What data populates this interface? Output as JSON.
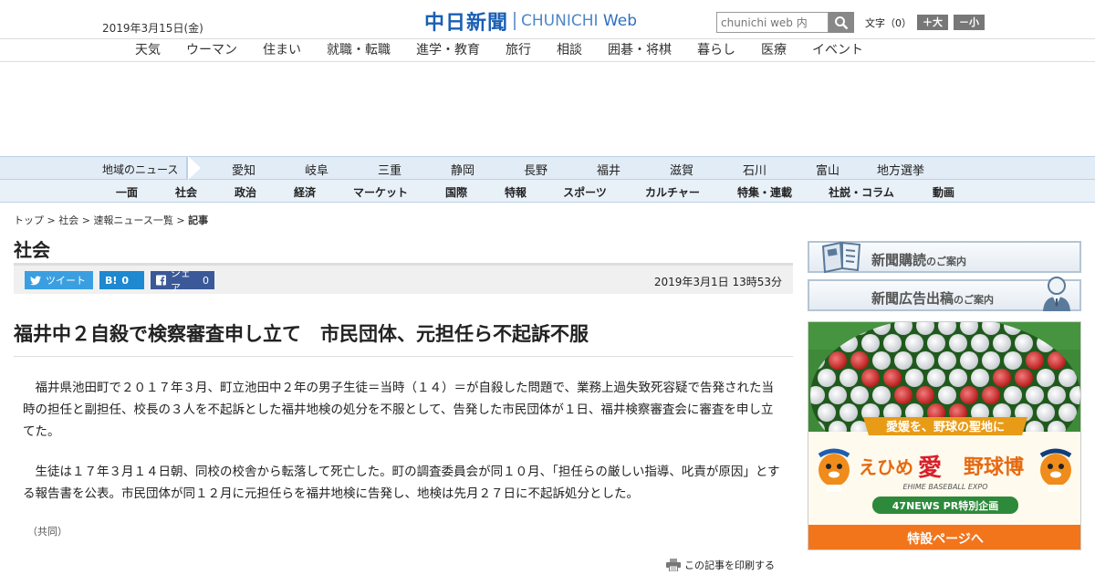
{
  "header": {
    "date": "2019年3月15日(金)",
    "logo_kanji": "中日新聞",
    "logo_en": "CHUNICHI",
    "logo_web": "Web",
    "search_placeholder": "chunichi web 内",
    "fontsize_label": "文字（0）",
    "fontsize_up": "＋大",
    "fontsize_down": "－小"
  },
  "subnav": [
    "天気",
    "ウーマン",
    "住まい",
    "就職・転職",
    "進学・教育",
    "旅行",
    "相談",
    "囲碁・将棋",
    "暮らし",
    "医療",
    "イベント"
  ],
  "region_nav": {
    "label": "地域のニュース",
    "items": [
      "愛知",
      "岐阜",
      "三重",
      "静岡",
      "長野",
      "福井",
      "滋賀",
      "石川",
      "富山",
      "地方選挙"
    ]
  },
  "main_nav": [
    "一面",
    "社会",
    "政治",
    "経済",
    "マーケット",
    "国際",
    "特報",
    "スポーツ",
    "カルチャー",
    "特集・連載",
    "社説・コラム",
    "動画"
  ],
  "breadcrumb": {
    "top": "トップ",
    "section": "社会",
    "list": "速報ニュース一覧",
    "current": "記事",
    "sep": " > "
  },
  "section_title": "社会",
  "share": {
    "tweet": "ツイート",
    "hatena_label": "B!",
    "hatena_count": "0",
    "fb_label": "シェア",
    "fb_count": "0"
  },
  "article": {
    "published": "2019年3月1日 13時53分",
    "headline": "福井中２自殺で検察審査申し立て　市民団体、元担任ら不起訴不服",
    "paragraphs": [
      "　福井県池田町で２０１７年３月、町立池田中２年の男子生徒＝当時（１４）＝が自殺した問題で、業務上過失致死容疑で告発された当時の担任と副担任、校長の３人を不起訴とした福井地検の処分を不服として、告発した市民団体が１日、福井検察審査会に審査を申し立てた。",
      "　生徒は１７年３月１４日朝、同校の校舎から転落して死亡した。町の調査委員会が同１０月、「担任らの厳しい指導、叱責が原因」とする報告書を公表。市民団体が同１２月に元担任らを福井地検に告発し、地検は先月２７日に不起訴処分とした。"
    ],
    "credit": "（共同）",
    "print_label": "この記事を印刷する"
  },
  "sidebar": {
    "banner1_main": "新聞購読",
    "banner1_sub": "のご案内",
    "banner2_main": "新聞広告出稿",
    "banner2_sub": "のご案内",
    "ad": {
      "catch": "愛媛を、野球の聖地に",
      "title_a": "えひめ",
      "title_b": "愛",
      "title_c": "野球博",
      "title_en": "EHIME BASEBALL EXPO",
      "pr": "47NEWS PR特別企画",
      "cta": "特設ページへ"
    }
  }
}
